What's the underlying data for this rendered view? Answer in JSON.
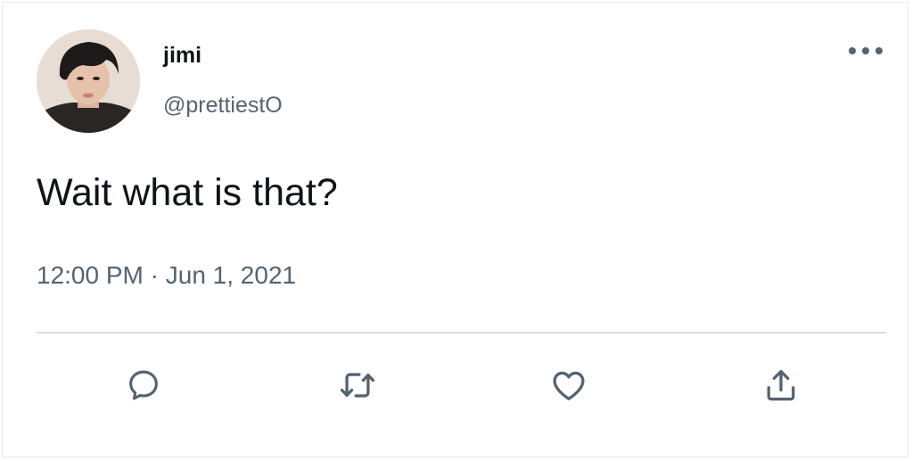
{
  "tweet": {
    "author": {
      "display_name": "jimi",
      "handle": "@prettiestO"
    },
    "text": "Wait what is that?",
    "time": "12:00 PM",
    "separator": "·",
    "date": "Jun 1, 2021"
  },
  "icons": {
    "more": "more-horizontal-icon",
    "reply": "reply-icon",
    "retweet": "retweet-icon",
    "like": "heart-icon",
    "share": "share-icon"
  },
  "colors": {
    "text_primary": "#0f1419",
    "text_secondary": "#536471",
    "divider": "#d8dde2"
  }
}
